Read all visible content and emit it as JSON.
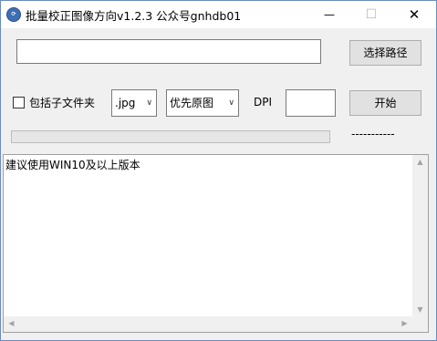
{
  "window": {
    "title": "批量校正图像方向v1.2.3 公众号gnhdb01",
    "icon": "app-logo-icon",
    "controls": {
      "minimize": "—",
      "maximize": "☐",
      "close": "✕"
    }
  },
  "path": {
    "value": "",
    "button_label": "选择路径"
  },
  "options": {
    "include_subfolders_label": "包括子文件夹",
    "include_subfolders_checked": false,
    "extension_value": ".jpg",
    "mode_value": "优先原图",
    "dpi_label": "DPI",
    "dpi_value": "",
    "chevron": "∨"
  },
  "actions": {
    "start_label": "开始"
  },
  "progress": {
    "value": 0,
    "status_text": "-----------"
  },
  "log": {
    "text": "建议使用WIN10及以上版本"
  },
  "scrollbars": {
    "up": "▲",
    "down": "▼",
    "left": "◀",
    "right": "▶"
  },
  "colors": {
    "progress_fill": "#06b025",
    "window_border": "#6a8cbf"
  }
}
